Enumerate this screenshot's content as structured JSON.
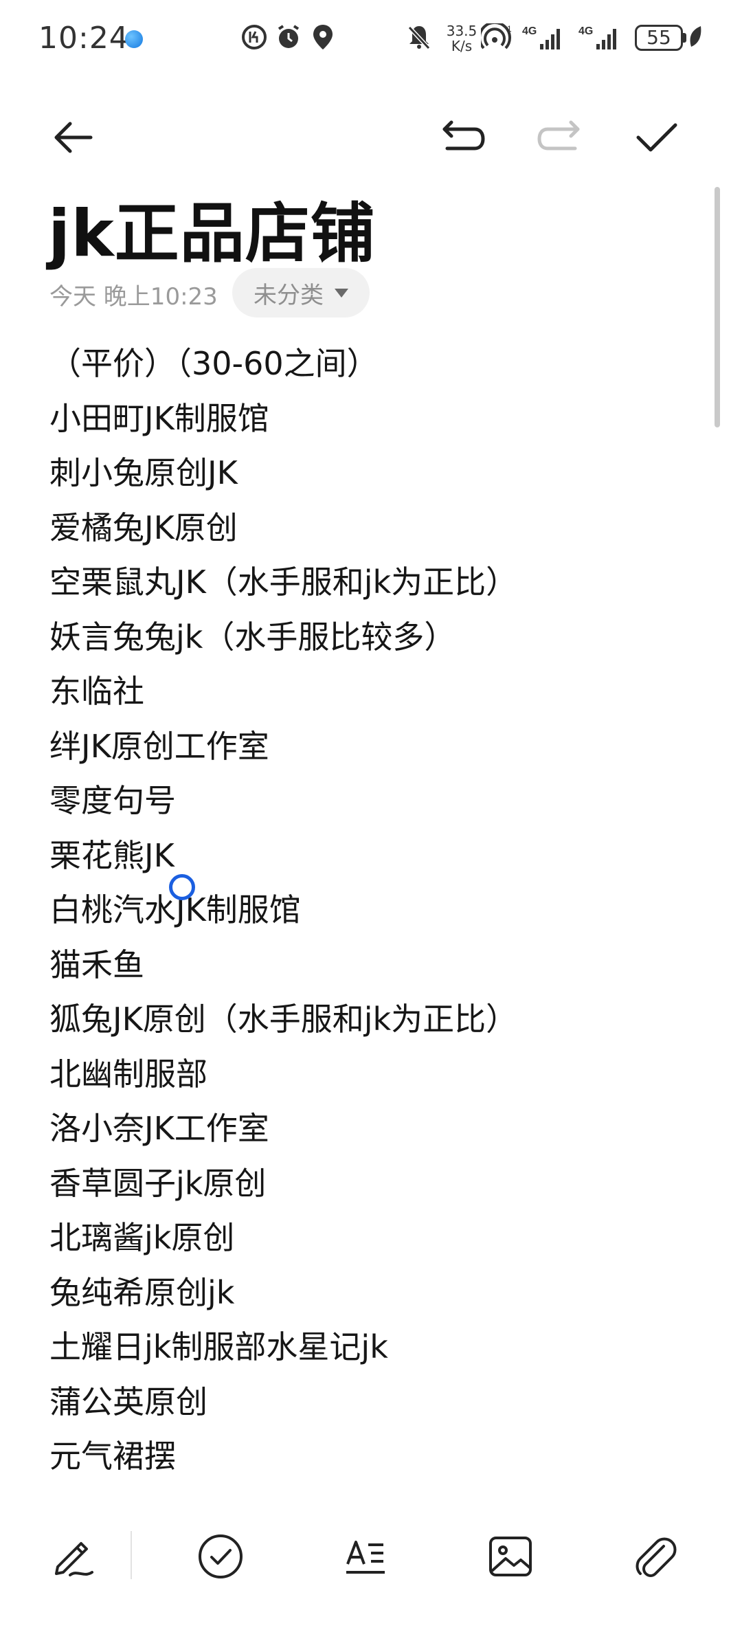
{
  "status_bar": {
    "time": "10:24",
    "net_speed_value": "33.5",
    "net_speed_unit": "K/s",
    "signal_1": "4G",
    "signal_2": "4G",
    "battery": "55"
  },
  "toolbar": {
    "icons": [
      "back-arrow-icon",
      "undo-icon",
      "redo-icon",
      "checkmark-icon"
    ]
  },
  "note": {
    "title": "jk正品店铺",
    "date": "今天 晚上10:23",
    "category": "未分类",
    "lines": [
      "（平价）（30-60之间）",
      "小田町JK制服馆",
      "刺小兔原创JK",
      "爱橘兔JK原创",
      "空栗鼠丸JK（水手服和jk为正比）",
      "妖言兔兔jk（水手服比较多）",
      "东临社",
      "绊JK原创工作室",
      "零度句号",
      "栗花熊JK",
      "白桃汽水JK制服馆",
      "猫禾鱼",
      "狐兔JK原创（水手服和jk为正比）",
      "北幽制服部",
      "洛小奈JK工作室",
      "香草圆子jk原创",
      "北璃酱jk原创",
      "兔纯希原创jk",
      "土耀日jk制服部水星记jk",
      "蒲公英原创",
      "元气裙摆"
    ]
  },
  "bottom_bar": {
    "icons": [
      "handwriting-pen-icon",
      "checklist-icon",
      "text-format-icon",
      "image-icon",
      "attachment-icon"
    ]
  },
  "colors": {
    "accent_blue": "#1b5fe0",
    "disabled_gray": "#c4c4c4"
  }
}
